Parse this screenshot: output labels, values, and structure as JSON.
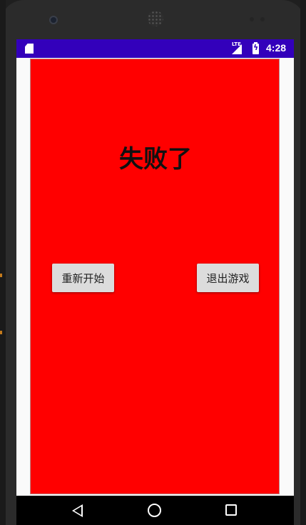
{
  "status_bar": {
    "time": "4:28",
    "network": "LTE",
    "icons": [
      "sd-card-icon",
      "signal-icon",
      "battery-charging-icon"
    ],
    "background": "#3300bb"
  },
  "game_over": {
    "title": "失败了",
    "background": "#ff0000",
    "restart_label": "重新开始",
    "quit_label": "退出游戏"
  },
  "nav_bar": {
    "icons": [
      "back-icon",
      "home-icon",
      "recents-icon"
    ]
  }
}
